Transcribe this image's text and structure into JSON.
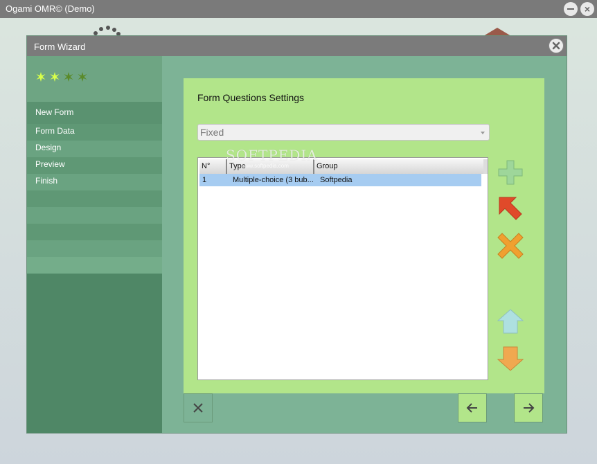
{
  "app": {
    "title": "Ogami OMR© (Demo)"
  },
  "dialog": {
    "title": "Form Wizard"
  },
  "sidebar": {
    "items": [
      {
        "label": "New Form"
      },
      {
        "label": "Form Data"
      },
      {
        "label": "Design"
      },
      {
        "label": "Preview"
      },
      {
        "label": "Finish"
      }
    ]
  },
  "panel": {
    "title": "Form Questions Settings",
    "dropdown_value": "Fixed",
    "columns": [
      "N°",
      "Type",
      "Group"
    ],
    "rows": [
      {
        "n": "1",
        "type": "Multiple-choice (3 bub...",
        "group": "Softpedia"
      }
    ],
    "watermark": "SOFTPEDIA",
    "watermark_sub": "www.softpedia.com"
  },
  "colors": {
    "dialog_bg": "#7db396",
    "sidebar_bg": "#4f8766",
    "panel_bg": "#b2e58a",
    "selection": "#a6ccf1",
    "add_icon": "#9ed69a",
    "edit_icon": "#e04a2a",
    "delete_icon": "#f0a030",
    "up_icon": "#aee0e0",
    "down_icon": "#f0a850"
  },
  "icons": {
    "add": "plus-icon",
    "edit": "edit-arrow-icon",
    "delete": "delete-x-icon",
    "move_up": "arrow-up-icon",
    "move_down": "arrow-down-icon",
    "cancel": "close-icon",
    "back": "arrow-left-icon",
    "next": "arrow-right-icon"
  }
}
